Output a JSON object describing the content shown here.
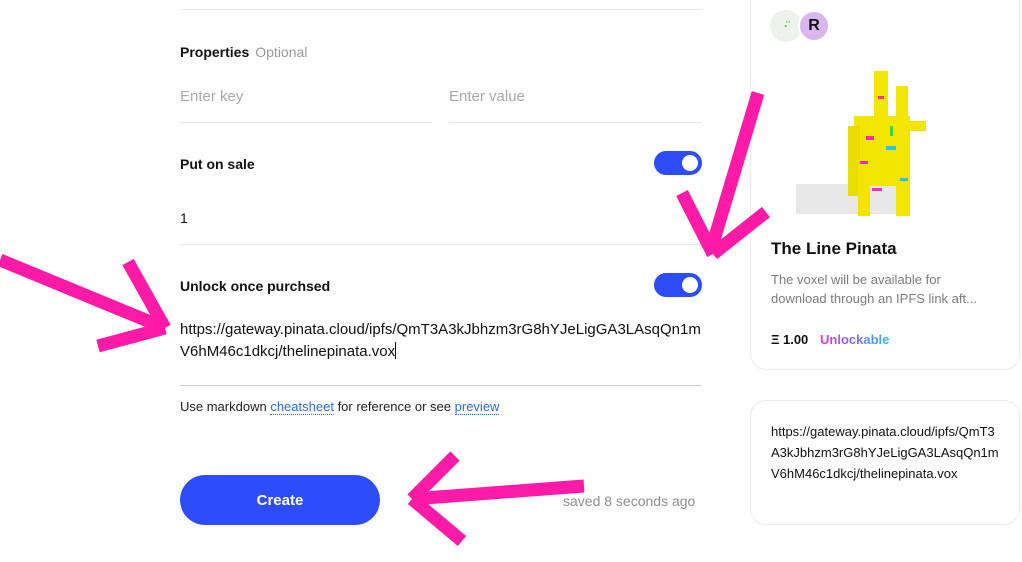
{
  "form": {
    "properties": {
      "title": "Properties",
      "optional": "Optional",
      "key_placeholder": "Enter key",
      "value_placeholder": "Enter value"
    },
    "sale": {
      "title": "Put on sale",
      "enabled": true,
      "price_value": "1"
    },
    "unlock": {
      "title": "Unlock once purchsed",
      "enabled": true,
      "content": "https://gateway.pinata.cloud/ipfs/QmT3A3kJbhzm3rG8hYJeLigGA3LAsqQn1mV6hM46c1dkcj/thelinepinata.vox"
    },
    "help": {
      "prefix": "Use markdown",
      "cheatsheet": "cheatsheet",
      "middle": "for reference or see",
      "preview": "preview"
    },
    "create_label": "Create",
    "saved_status": "saved 8 seconds ago"
  },
  "preview_card": {
    "avatar_1_glyph": "·̈",
    "avatar_2_glyph": "R",
    "title": "The Line Pinata",
    "description": "The voxel will be available for download through an IPFS link aft...",
    "price": "Ξ 1.00",
    "unlockable_label": "Unlockable"
  },
  "unlock_preview": {
    "text": "https://gateway.pinata.cloud/ipfs/QmT3A3kJbhzm3rG8hYJeLigGA3LAsqQn1mV6hM46c1dkcj/thelinepinata.vox"
  },
  "colors": {
    "accent": "#2d4dfa",
    "arrow": "#ff1aa8",
    "link": "#2d6ae0"
  }
}
